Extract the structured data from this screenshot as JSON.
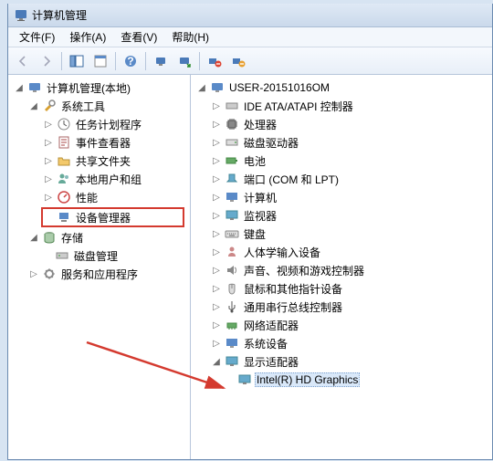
{
  "title": "计算机管理",
  "menu": {
    "file": "文件(F)",
    "action": "操作(A)",
    "view": "查看(V)",
    "help": "帮助(H)"
  },
  "left_tree": {
    "root": "计算机管理(本地)",
    "system_tools": "系统工具",
    "task_scheduler": "任务计划程序",
    "event_viewer": "事件查看器",
    "shared_folders": "共享文件夹",
    "local_users": "本地用户和组",
    "performance": "性能",
    "device_manager": "设备管理器",
    "storage": "存储",
    "disk_mgmt": "磁盘管理",
    "services_apps": "服务和应用程序"
  },
  "right_tree": {
    "root": "USER-20151016OM",
    "ide": "IDE ATA/ATAPI 控制器",
    "cpu": "处理器",
    "disk": "磁盘驱动器",
    "battery": "电池",
    "ports": "端口 (COM 和 LPT)",
    "computer": "计算机",
    "monitor": "监视器",
    "keyboard": "键盘",
    "hid": "人体学输入设备",
    "sound": "声音、视频和游戏控制器",
    "mouse": "鼠标和其他指针设备",
    "usb": "通用串行总线控制器",
    "network": "网络适配器",
    "sysdev": "系统设备",
    "display": "显示适配器",
    "gpu": "Intel(R) HD Graphics"
  }
}
